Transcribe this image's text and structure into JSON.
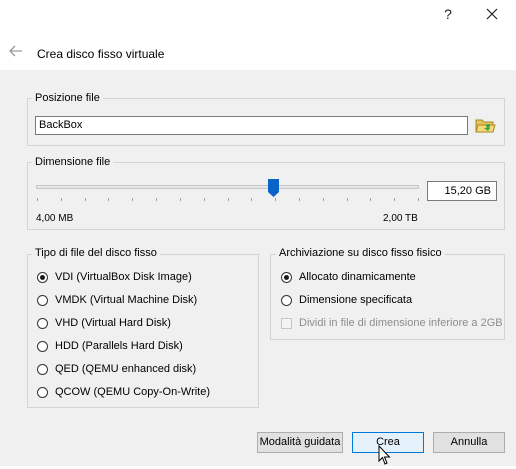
{
  "titlebar": {
    "help_label": "?",
    "close_icon": "close-icon"
  },
  "header": {
    "title": "Crea disco fisso virtuale",
    "back_icon": "back-arrow-icon"
  },
  "file_location": {
    "group_title": "Posizione file",
    "value": "BackBox",
    "browse_icon": "folder-icon"
  },
  "file_size": {
    "group_title": "Dimensione file",
    "value": "15,20 GB",
    "min_label": "4,00 MB",
    "max_label": "2,00 TB",
    "slider_fraction": 0.62
  },
  "disk_type": {
    "group_title": "Tipo di file del disco fisso",
    "options": [
      {
        "label": "VDI (VirtualBox Disk Image)",
        "checked": true
      },
      {
        "label": "VMDK (Virtual Machine Disk)",
        "checked": false
      },
      {
        "label": "VHD (Virtual Hard Disk)",
        "checked": false
      },
      {
        "label": "HDD (Parallels Hard Disk)",
        "checked": false
      },
      {
        "label": "QED (QEMU enhanced disk)",
        "checked": false
      },
      {
        "label": "QCOW (QEMU Copy-On-Write)",
        "checked": false
      }
    ]
  },
  "storage": {
    "group_title": "Archiviazione su disco fisso fisico",
    "options": [
      {
        "label": "Allocato dinamicamente",
        "checked": true
      },
      {
        "label": "Dimensione specificata",
        "checked": false
      }
    ],
    "split_label": "Dividi in file di dimensione inferiore a 2GB",
    "split_checked": false,
    "split_enabled": false
  },
  "buttons": {
    "guided": "Modalità guidata",
    "create": "Crea",
    "cancel": "Annulla"
  },
  "colors": {
    "accent": "#0078d7",
    "thumb": "#0a64c8",
    "background": "#f0f0f0"
  }
}
